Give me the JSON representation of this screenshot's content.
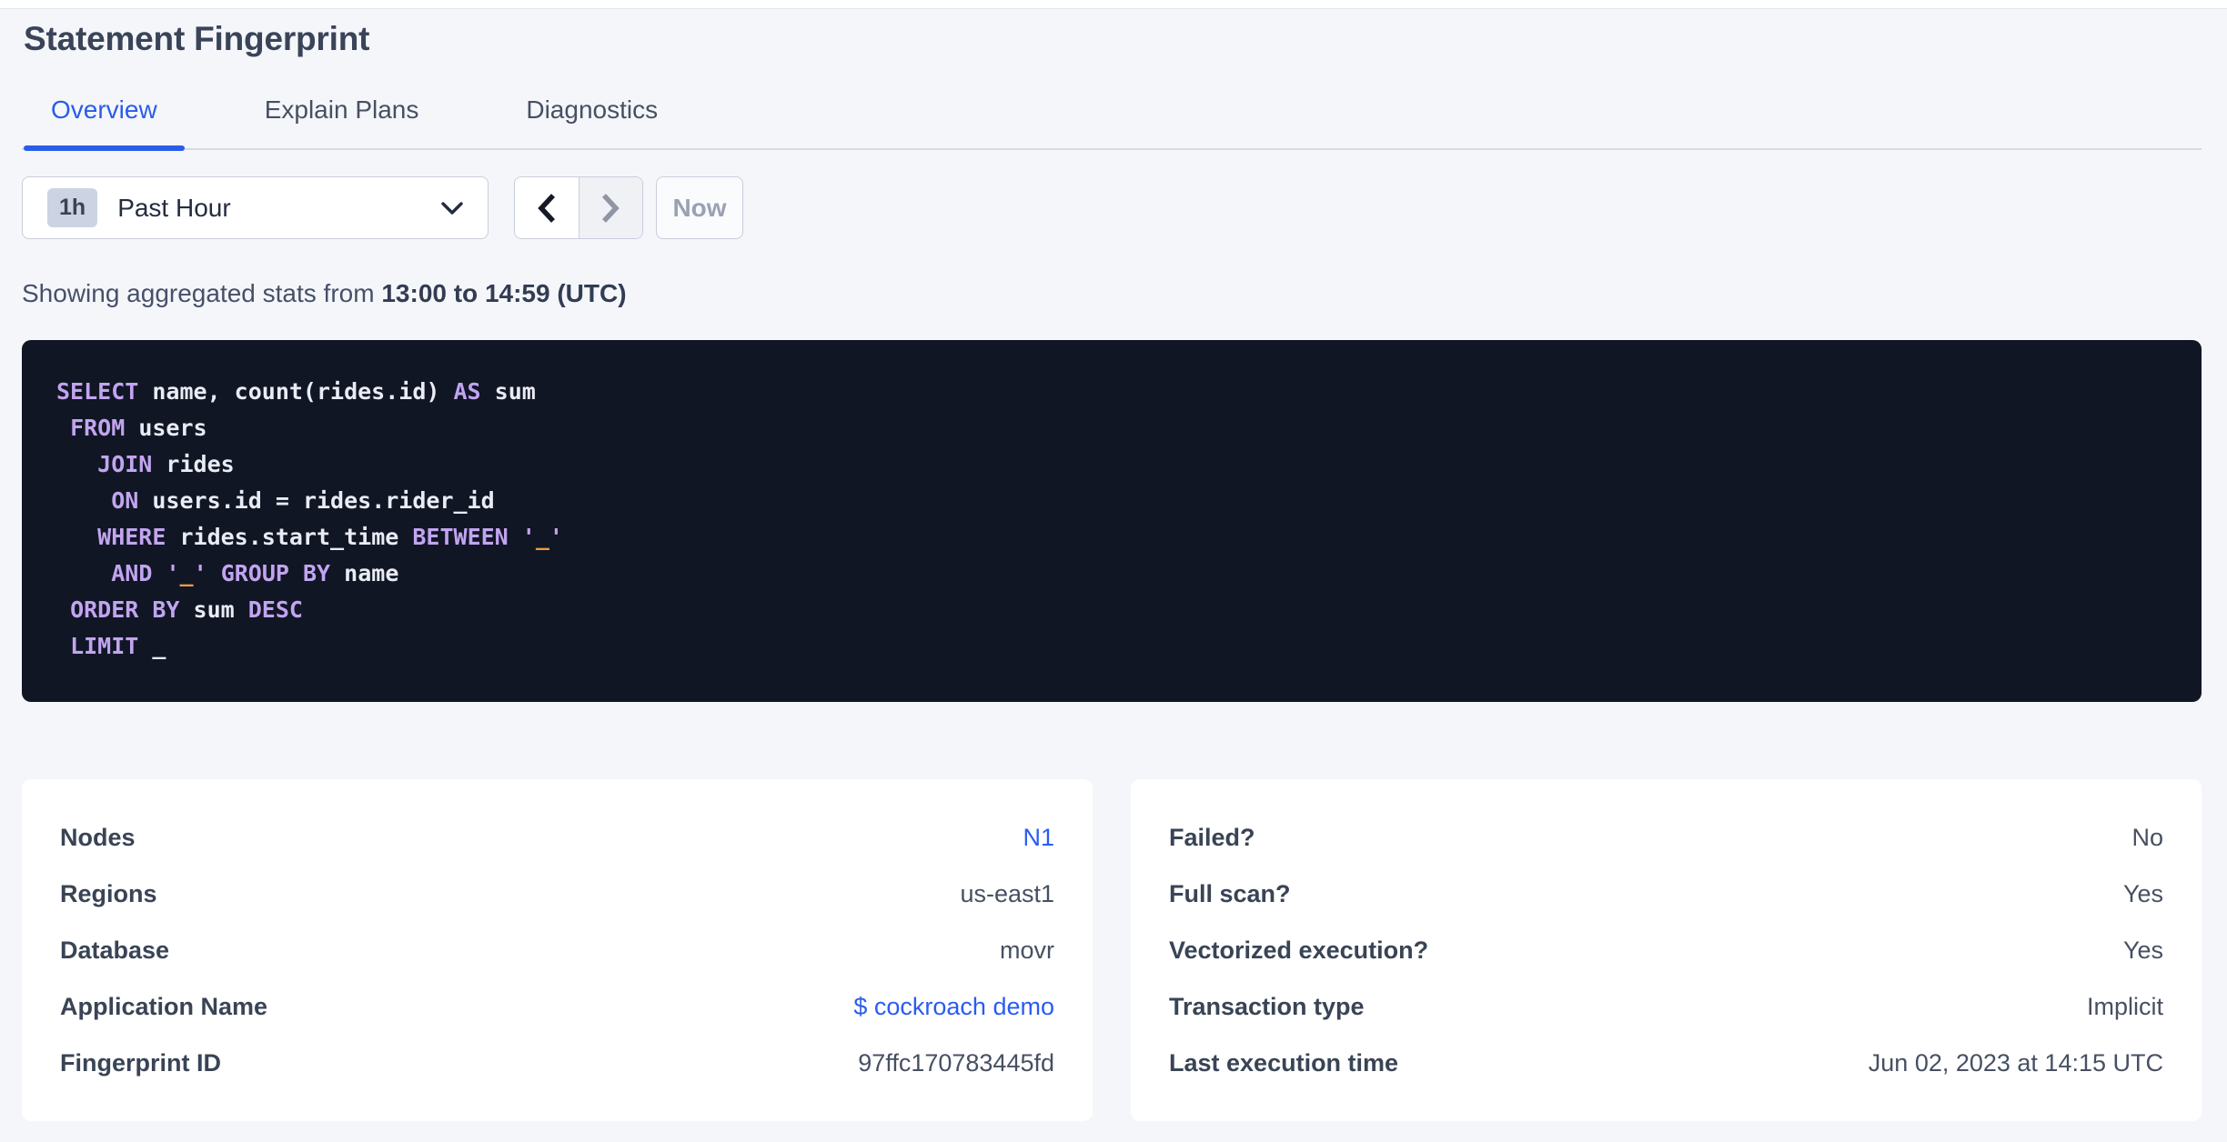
{
  "page": {
    "title": "Statement Fingerprint"
  },
  "tabs": [
    {
      "label": "Overview",
      "active": true
    },
    {
      "label": "Explain Plans",
      "active": false
    },
    {
      "label": "Diagnostics",
      "active": false
    }
  ],
  "toolbar": {
    "time_badge": "1h",
    "time_label": "Past Hour",
    "now_label": "Now",
    "icons": [
      "chevron-down-icon",
      "chevron-left-icon",
      "chevron-right-icon"
    ]
  },
  "stats_line": {
    "prefix": "Showing aggregated stats from ",
    "range": "13:00 to 14:59 (UTC)"
  },
  "sql": {
    "lines": [
      [
        [
          "kw",
          "SELECT"
        ],
        [
          "id",
          " name, count(rides.id) "
        ],
        [
          "kw",
          "AS"
        ],
        [
          "id",
          " sum"
        ]
      ],
      [
        [
          "id",
          " "
        ],
        [
          "kw",
          "FROM"
        ],
        [
          "id",
          " users"
        ]
      ],
      [
        [
          "id",
          "   "
        ],
        [
          "kw",
          "JOIN"
        ],
        [
          "id",
          " rides"
        ]
      ],
      [
        [
          "id",
          "    "
        ],
        [
          "kw",
          "ON"
        ],
        [
          "id",
          " users.id = rides.rider_id"
        ]
      ],
      [
        [
          "id",
          "   "
        ],
        [
          "kw",
          "WHERE"
        ],
        [
          "id",
          " rides.start_time "
        ],
        [
          "kw",
          "BETWEEN"
        ],
        [
          "id",
          " "
        ],
        [
          "kw",
          "'"
        ],
        [
          "or",
          "_"
        ],
        [
          "kw",
          "'"
        ]
      ],
      [
        [
          "id",
          "    "
        ],
        [
          "kw",
          "AND"
        ],
        [
          "id",
          " "
        ],
        [
          "kw",
          "'"
        ],
        [
          "or",
          "_"
        ],
        [
          "kw",
          "'"
        ],
        [
          "id",
          " "
        ],
        [
          "kw",
          "GROUP BY"
        ],
        [
          "id",
          " name"
        ]
      ],
      [
        [
          "id",
          " "
        ],
        [
          "kw",
          "ORDER BY"
        ],
        [
          "id",
          " sum "
        ],
        [
          "kw",
          "DESC"
        ]
      ],
      [
        [
          "id",
          " "
        ],
        [
          "kw",
          "LIMIT"
        ],
        [
          "id",
          " _"
        ]
      ]
    ]
  },
  "cards": {
    "left": {
      "rows": [
        {
          "label": "Nodes",
          "value": "N1",
          "type": "link"
        },
        {
          "label": "Regions",
          "value": "us-east1",
          "type": "text"
        },
        {
          "label": "Database",
          "value": "movr",
          "type": "text"
        },
        {
          "label": "Application Name",
          "value": "$ cockroach demo",
          "type": "link"
        },
        {
          "label": "Fingerprint ID",
          "value": "97ffc170783445fd",
          "type": "text"
        }
      ]
    },
    "right": {
      "rows": [
        {
          "label": "Failed?",
          "value": "No",
          "type": "text"
        },
        {
          "label": "Full scan?",
          "value": "Yes",
          "type": "text"
        },
        {
          "label": "Vectorized execution?",
          "value": "Yes",
          "type": "text"
        },
        {
          "label": "Transaction type",
          "value": "Implicit",
          "type": "text"
        },
        {
          "label": "Last execution time",
          "value": "Jun 02, 2023 at 14:15 UTC",
          "type": "text"
        }
      ]
    }
  },
  "colors": {
    "accent_blue": "#2a5ce8",
    "link_blue": "#2a5cf0",
    "page_background": "#f4f6fa",
    "sql_background": "#101624",
    "sql_keyword": "#c2a4f0",
    "sql_literal_orange": "#ef9b3f",
    "sql_text": "#e9ebf5",
    "label_dark": "#394455"
  }
}
